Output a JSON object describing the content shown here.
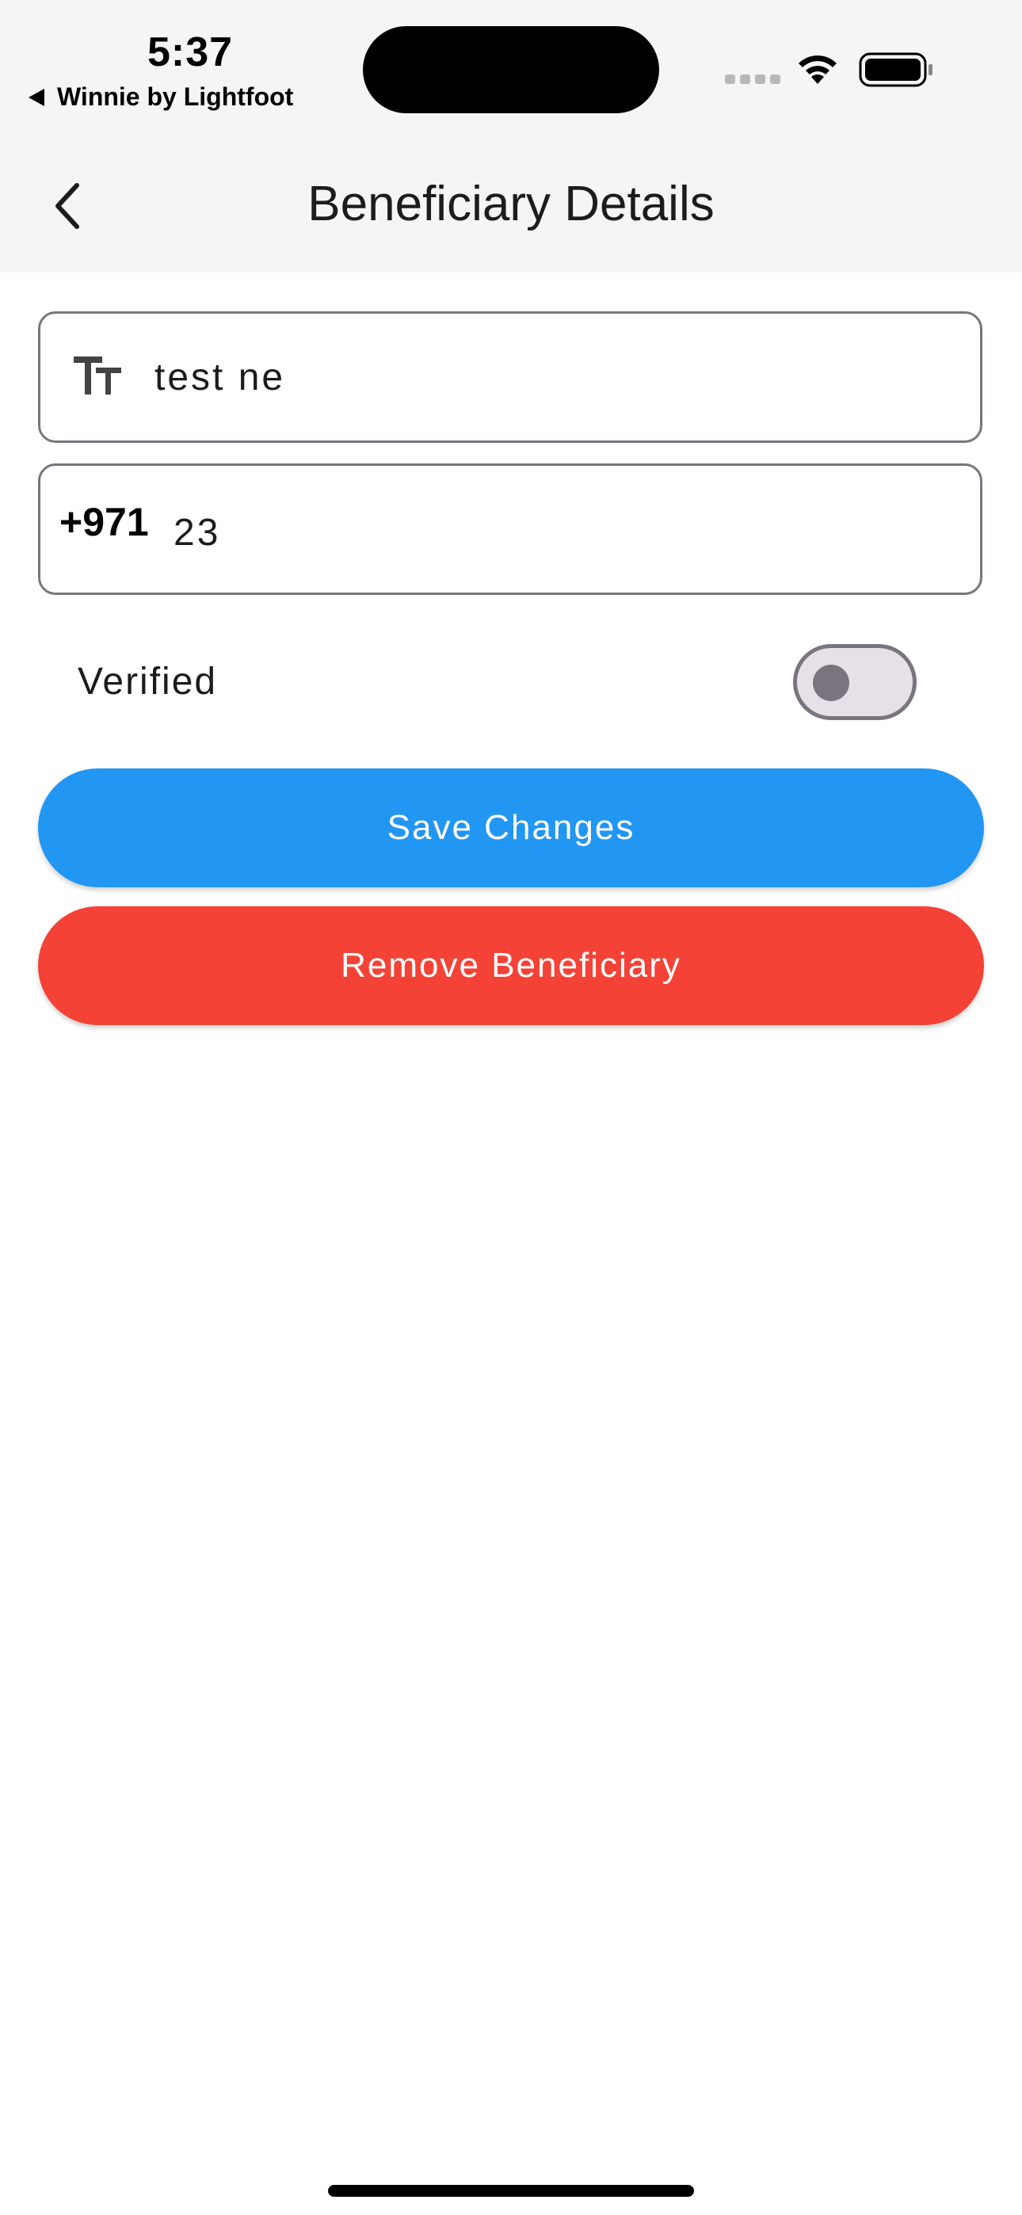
{
  "status_bar": {
    "time": "5:37",
    "back_app": "Winnie by Lightfoot"
  },
  "header": {
    "title": "Beneficiary Details"
  },
  "form": {
    "name_value": "test ne",
    "phone_prefix": "+971",
    "phone_value": "23",
    "verified_label": "Verified",
    "verified": false
  },
  "actions": {
    "save_label": "Save Changes",
    "remove_label": "Remove Beneficiary"
  },
  "colors": {
    "save": "#2196f3",
    "remove": "#f44336",
    "toggle_off": "#e6e0e9"
  },
  "icons": [
    "back-chevron-icon",
    "text-format-icon",
    "wifi-icon",
    "battery-icon"
  ]
}
